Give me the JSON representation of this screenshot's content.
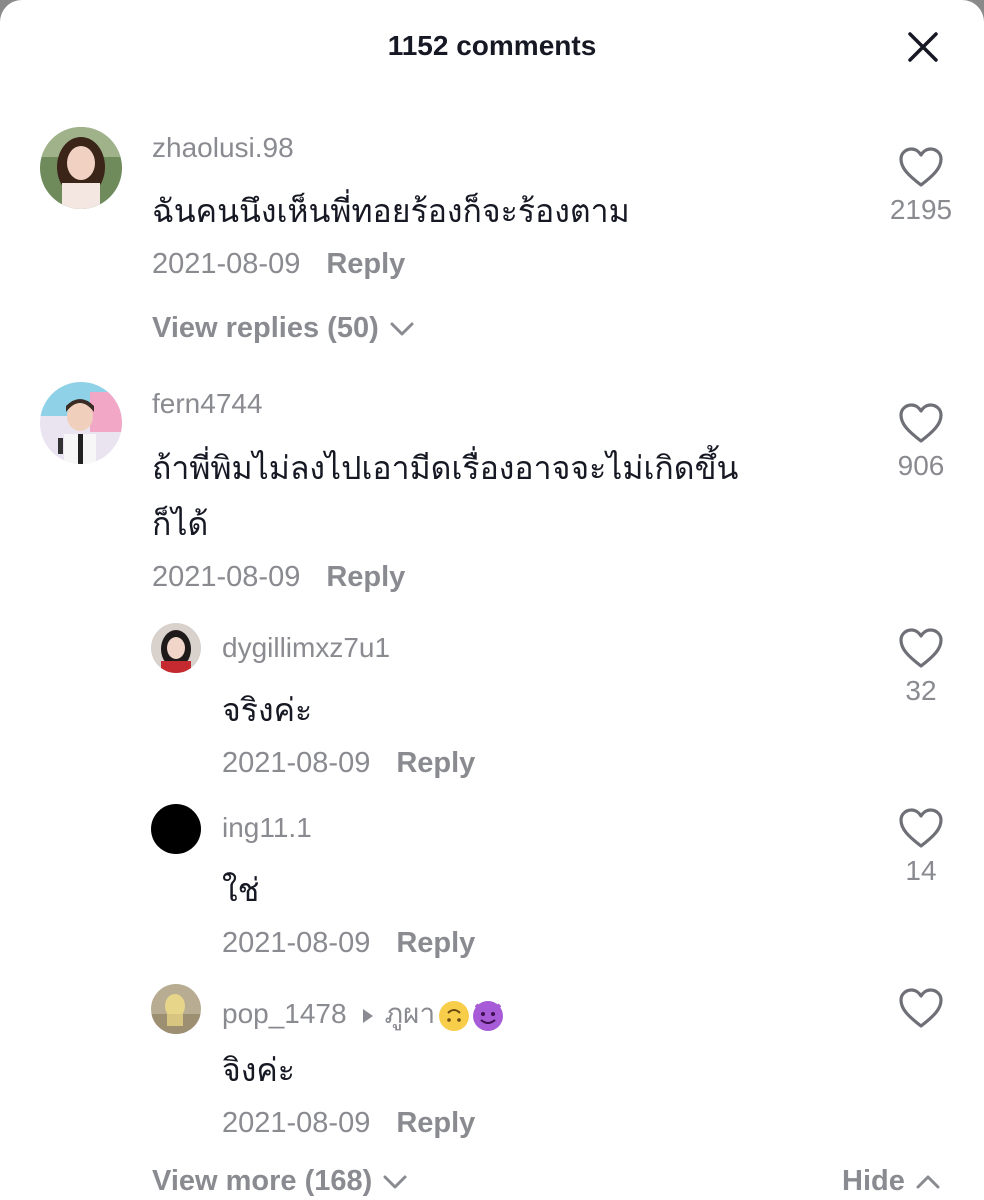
{
  "header": {
    "title": "1152 comments"
  },
  "comments": [
    {
      "username": "zhaolusi.98",
      "text": "ฉันคนนึงเห็นพี่ทอยร้องก็จะร้องตาม",
      "date": "2021-08-09",
      "reply_label": "Reply",
      "likes": "2195",
      "view_replies": "View replies (50)"
    },
    {
      "username": "fern4744",
      "text_line1": "ถ้าพี่พิมไม่ลงไปเอามีดเรื่องอาจจะไม่เกิดขึ้น",
      "text_line2": "ก็ได้",
      "date": "2021-08-09",
      "reply_label": "Reply",
      "likes": "906"
    }
  ],
  "replies": [
    {
      "username": "dygillimxz7u1",
      "text": "จริงค่ะ",
      "date": "2021-08-09",
      "reply_label": "Reply",
      "likes": "32"
    },
    {
      "username": "ing11.1",
      "text": "ใช่",
      "date": "2021-08-09",
      "reply_label": "Reply",
      "likes": "14"
    },
    {
      "username": "pop_1478",
      "reply_to": "ภูผา",
      "text": "จิงค่ะ",
      "date": "2021-08-09",
      "reply_label": "Reply",
      "likes": ""
    }
  ],
  "footer": {
    "view_more": "View more (168)",
    "hide": "Hide"
  }
}
